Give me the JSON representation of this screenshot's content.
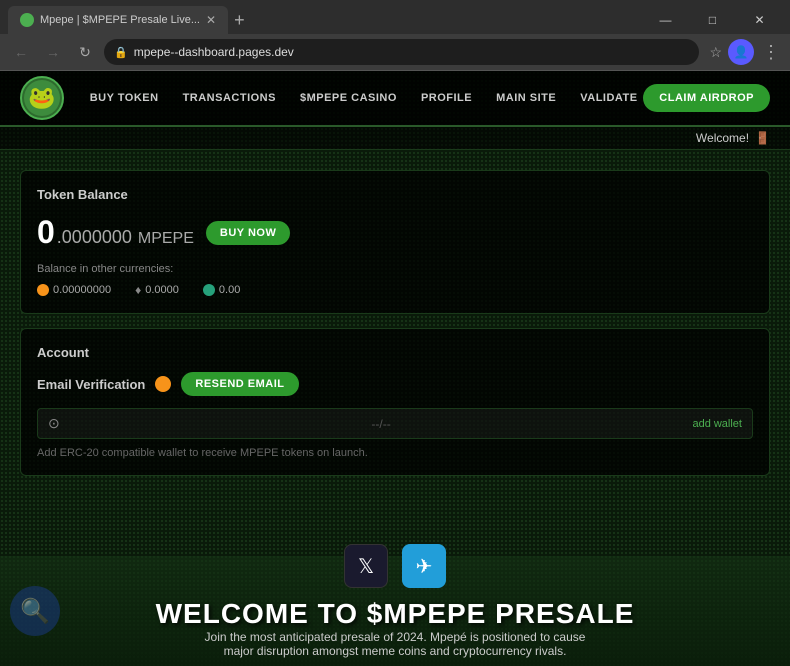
{
  "browser": {
    "tab_title": "Mpepe | $MPEPE Presale Live...",
    "url": "mpepe--dashboard.pages.dev",
    "new_tab_icon": "+",
    "window_controls": [
      "—",
      "□",
      "✕"
    ]
  },
  "nav": {
    "logo_emoji": "🐸",
    "links": [
      "BUY TOKEN",
      "TRANSACTIONS",
      "$MPEPE CASINO",
      "PROFILE",
      "MAIN SITE",
      "VALIDATE"
    ],
    "cta_label": "CLAIM AIRDROP"
  },
  "welcome_bar": {
    "text": "Welcome!",
    "icon": "🚪"
  },
  "token_balance": {
    "title": "Token Balance",
    "zero": "0",
    "decimals": ".0000000",
    "currency": "MPEPE",
    "buy_now_label": "BUY NOW",
    "balance_label": "Balance in other currencies:",
    "currencies": [
      {
        "symbol": "₿",
        "value": "0.00000000",
        "type": "btc"
      },
      {
        "symbol": "Ξ",
        "value": "0.0000",
        "type": "eth"
      },
      {
        "symbol": "●",
        "value": "0.00",
        "type": "usdt"
      }
    ]
  },
  "account": {
    "title": "Account",
    "email_verification_label": "Email Verification",
    "resend_email_label": "RESEND EMAIL",
    "wallet_placeholder": "--/--",
    "add_wallet_label": "add wallet",
    "wallet_hint": "Add ERC-20 compatible wallet to receive MPEPE tokens on launch."
  },
  "bottom_section": {
    "presale_heading": "WELCOME TO $MPEPE PRESALE",
    "presale_subtext": "Join the most anticipated presale of 2024. Mpepé is positioned to cause major disruption amongst meme coins and cryptocurrency rivals.",
    "social_buttons": [
      {
        "label": "X",
        "type": "twitter"
      },
      {
        "label": "✈",
        "type": "telegram"
      }
    ]
  }
}
